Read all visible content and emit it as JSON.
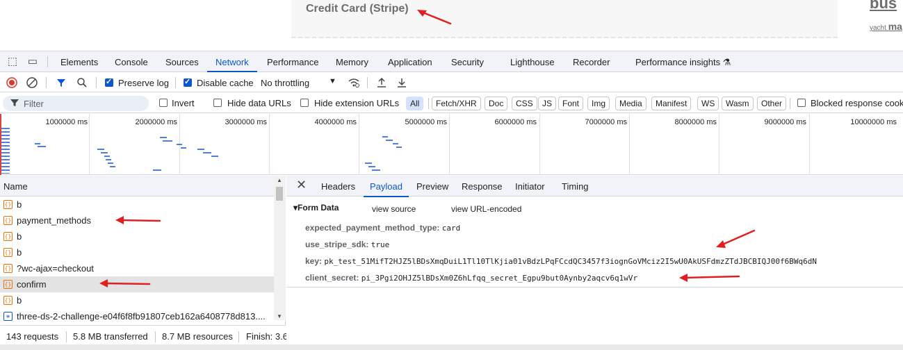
{
  "page": {
    "card_title": "Credit Card (Stripe)",
    "side_big": "bus",
    "side_small_a": "yacht",
    "side_small_b": "ma"
  },
  "devtools_tabs": [
    "Elements",
    "Console",
    "Sources",
    "Network",
    "Performance",
    "Memory",
    "Application",
    "Security",
    "Lighthouse",
    "Recorder",
    "Performance insights"
  ],
  "active_tab": "Network",
  "toolbar": {
    "preserve_log_label": "Preserve log",
    "preserve_log_checked": true,
    "disable_cache_label": "Disable cache",
    "disable_cache_checked": true,
    "throttling": "No throttling"
  },
  "filterbar": {
    "filter_placeholder": "Filter",
    "invert_label": "Invert",
    "hide_data_urls_label": "Hide data URLs",
    "hide_extension_urls_label": "Hide extension URLs",
    "chips": [
      "All",
      "Fetch/XHR",
      "Doc",
      "CSS",
      "JS",
      "Font",
      "Img",
      "Media",
      "Manifest",
      "WS",
      "Wasm",
      "Other"
    ],
    "blocked_label": "Blocked response cook"
  },
  "overview": {
    "ticks": [
      "1000000 ms",
      "2000000 ms",
      "3000000 ms",
      "4000000 ms",
      "5000000 ms",
      "6000000 ms",
      "7000000 ms",
      "8000000 ms",
      "9000000 ms",
      "10000000 ms"
    ]
  },
  "requests": {
    "header": "Name",
    "rows": [
      {
        "name": "b",
        "icon": "xhr"
      },
      {
        "name": "payment_methods",
        "icon": "xhr"
      },
      {
        "name": "b",
        "icon": "xhr"
      },
      {
        "name": "b",
        "icon": "xhr"
      },
      {
        "name": "?wc-ajax=checkout",
        "icon": "xhr"
      },
      {
        "name": "confirm",
        "icon": "xhr",
        "selected": true
      },
      {
        "name": "b",
        "icon": "xhr"
      },
      {
        "name": "three-ds-2-challenge-e04f6f8fb91807ceb162a6408778d813....",
        "icon": "doc"
      }
    ]
  },
  "status": {
    "requests": "143 requests",
    "transferred": "5.8 MB transferred",
    "resources": "8.7 MB resources",
    "finish": "Finish: 3.6"
  },
  "detail_tabs": [
    "Headers",
    "Payload",
    "Preview",
    "Response",
    "Initiator",
    "Timing"
  ],
  "active_detail_tab": "Payload",
  "payload": {
    "section_title": "Form Data",
    "view_source": "view source",
    "view_url_encoded": "view URL-encoded",
    "fields": [
      {
        "key": "expected_payment_method_type:",
        "value": "card"
      },
      {
        "key": "use_stripe_sdk:",
        "value": "true"
      },
      {
        "key": "key:",
        "value": "pk_test_51MifT2HJZ5lBDsXmqDuiL1Tl10TlKjia01vBdzLPqFCcdQC3457f3iognGoVMciz2I5wU0AkUSFdmzZTdJBCBIQJ00f6BWq6dN"
      },
      {
        "key": "client_secret:",
        "value": "pi_3Pgi2OHJZ5lBDsXm0Z6hLfqq_secret_Egpu9but0Aynby2aqcv6q1wVr"
      }
    ]
  },
  "colors": {
    "accent": "#0b57d0",
    "annotation_arrow": "#e02020",
    "xhr_icon": "#e8710a"
  }
}
